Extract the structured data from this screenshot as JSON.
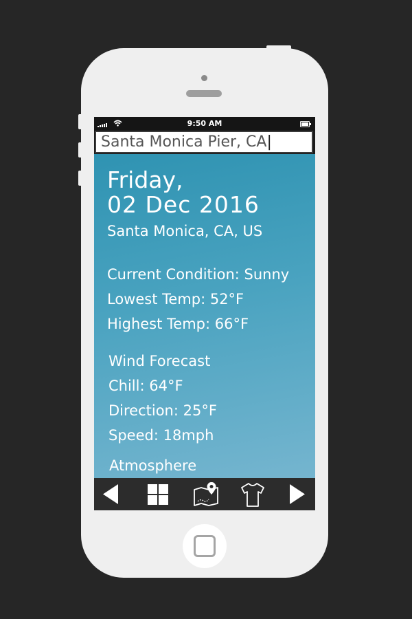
{
  "status_bar": {
    "time": "9:50 AM"
  },
  "search": {
    "value": "Santa Monica Pier, CA"
  },
  "weather": {
    "day": "Friday,",
    "date": "02 Dec 2016",
    "location": "Santa Monica, CA, US",
    "current_condition": "Current Condition: Sunny",
    "lowest_temp": "Lowest Temp: 52°F",
    "highest_temp": "Highest Temp: 66°F"
  },
  "wind": {
    "title": "Wind Forecast",
    "chill": "Chill: 64°F",
    "direction": "Direction: 25°F",
    "speed": "Speed: 18mph"
  },
  "atmosphere": {
    "title": "Atmosphere"
  },
  "nav": {
    "icons": [
      "back-arrow-icon",
      "grid-icon",
      "map-pin-icon",
      "shirt-icon",
      "forward-arrow-icon"
    ]
  },
  "colors": {
    "background": "#262626",
    "phone_body": "#efefef",
    "content_top": "#2f93b2",
    "content_bottom": "#75b5cf",
    "nav_bar": "#2c2c2c"
  }
}
